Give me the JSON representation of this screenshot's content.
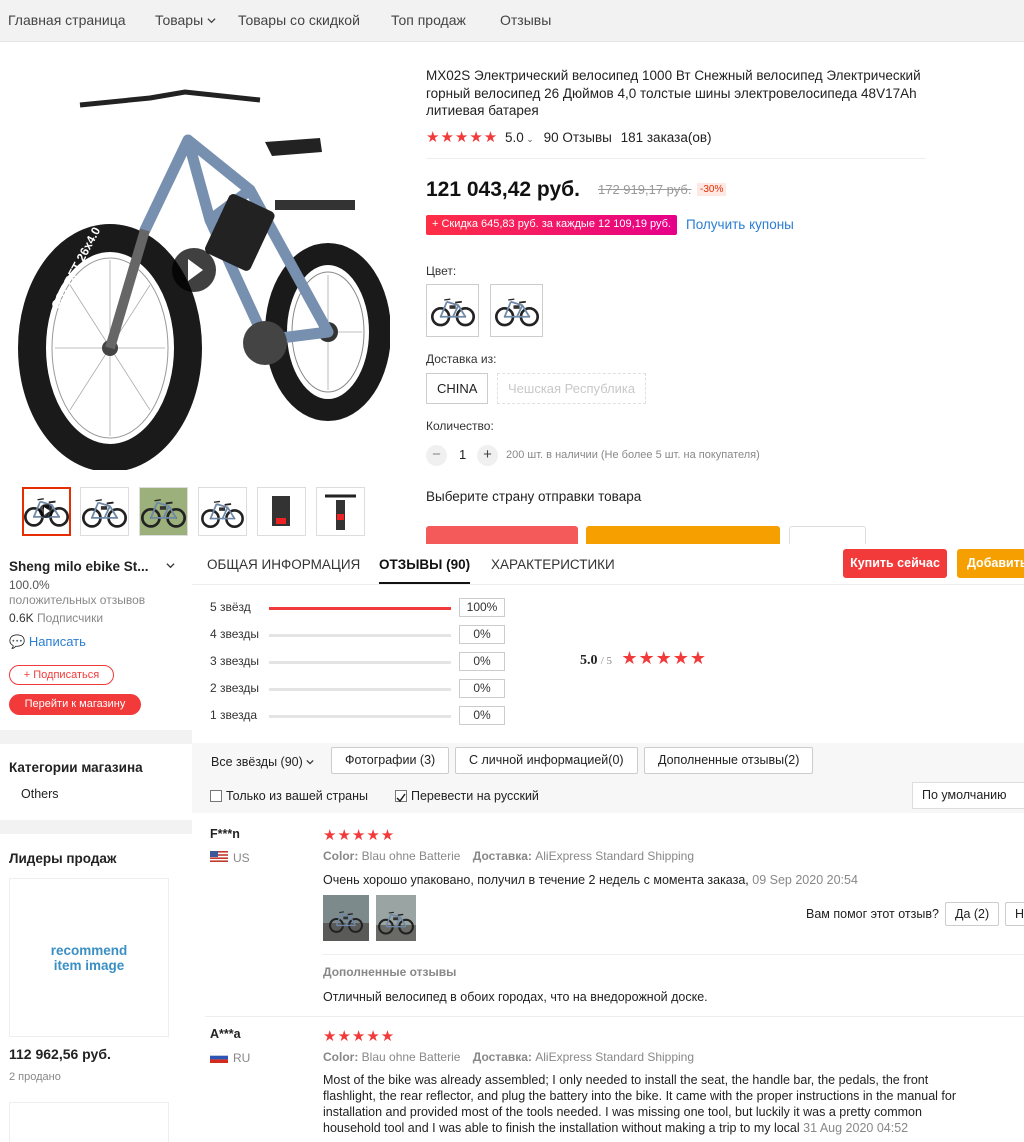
{
  "nav": {
    "home": "Главная страница",
    "products": "Товары",
    "discounted": "Товары со скидкой",
    "top": "Топ продаж",
    "reviews": "Отзывы"
  },
  "product": {
    "title": "MX02S Электрический велосипед 1000 Вт Снежный велосипед Электрический горный велосипед 26 Дюймов 4,0 толстые шины электровелосипеда 48V17Ah литиевая батарея",
    "tire_text": "CST BFT 26x4.0",
    "rating": "5.0",
    "rating_stars": 5,
    "reviews_count": "90 Отзывы",
    "orders": "181 заказа(ов)",
    "price": "121 043,42 руб.",
    "old_price": "172 919,17 руб.",
    "discount": "-30%",
    "coupon": "+ Скидка 645,83 руб. за каждые 12 109,19 руб.",
    "get_coupons": "Получить купоны",
    "color_label": "Цвет:",
    "ship_from_label": "Доставка из:",
    "ship_options": [
      "CHINA",
      "Чешская Республика"
    ],
    "qty_label": "Количество:",
    "qty": "1",
    "stock": "200 шт. в наличии (Не более 5 шт. на покупателя)",
    "choose_country": "Выберите страну отправки товара"
  },
  "store": {
    "name": "Sheng milo ebike St...",
    "positive": "100.0%",
    "positive_label": "положительных отзывов",
    "followers": "0.6K",
    "followers_label": "Подписчики",
    "write": "Написать",
    "subscribe": "+ Подписаться",
    "go_store": "Перейти к магазину",
    "categories_title": "Категории магазина",
    "category": "Others",
    "leaders_title": "Лидеры продаж",
    "recommend": "recommend item image",
    "leader_price": "112 962,56 руб.",
    "leader_sold": "2 продано"
  },
  "tabs": {
    "general": "ОБЩАЯ ИНФОРМАЦИЯ",
    "reviews": "ОТЗЫВЫ (90)",
    "specs": "ХАРАКТЕРИСТИКИ",
    "buy_now": "Купить сейчас",
    "add": "Добавить"
  },
  "rating_bars": [
    {
      "label": "5 звёзд",
      "pct": "100%",
      "value": 1.0
    },
    {
      "label": "4 звезды",
      "pct": "0%",
      "value": 0
    },
    {
      "label": "3 звезды",
      "pct": "0%",
      "value": 0
    },
    {
      "label": "2 звезды",
      "pct": "0%",
      "value": 0
    },
    {
      "label": "1 звезда",
      "pct": "0%",
      "value": 0
    }
  ],
  "summary": {
    "score": "5.0",
    "outof": "/ 5"
  },
  "filters": {
    "all": "Все звёзды (90)",
    "photos": "Фотографии (3)",
    "personal": "С личной информацией(0)",
    "additional": "Дополненные отзывы(2)",
    "only_country": "Только из вашей страны",
    "translate": "Перевести на русский",
    "sort": "По умолчанию"
  },
  "reviews": [
    {
      "name": "F***n",
      "country": "US",
      "color_label": "Color:",
      "color": "Blau ohne Batterie",
      "ship_label": "Доставка:",
      "ship": "AliExpress Standard Shipping",
      "text": "Очень хорошо упаковано, получил в течение 2 недель с момента заказа,",
      "date": "09 Sep 2020 20:54",
      "helpful": "Вам помог этот отзыв?",
      "yes": "Да (2)",
      "no": "Не",
      "additional_label": "Дополненные отзывы",
      "additional_text": "Отличный велосипед в обоих городах, что на внедорожной доске."
    },
    {
      "name": "A***a",
      "country": "RU",
      "color_label": "Color:",
      "color": "Blau ohne Batterie",
      "ship_label": "Доставка:",
      "ship": "AliExpress Standard Shipping",
      "text": "Most of the bike was already assembled; I only needed to install the seat, the handle bar, the pedals, the front flashlight, the rear reflector, and plug the battery into the bike. It came with the proper instructions in the manual for installation and provided most of the tools needed. I was missing one tool, but luckily it was a pretty common household tool and I was able to finish the installation without making a trip to my local",
      "date": "31 Aug 2020 04:52"
    }
  ],
  "colors": {
    "accent": "#f23a3a",
    "orange": "#f5a000",
    "link": "#2a7ed4"
  }
}
